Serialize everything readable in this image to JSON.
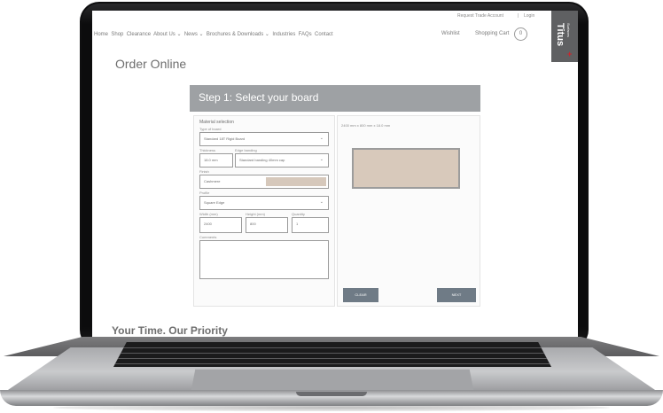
{
  "header": {
    "top_links": [
      "Request Trade Account",
      "Login"
    ],
    "nav_items": [
      "Home",
      "Shop",
      "Clearance",
      "About Us",
      "News",
      "Brochures & Downloads",
      "Industries",
      "FAQs",
      "Contact"
    ],
    "wishlist_label": "Wishlist",
    "cart_label": "Shopping Cart",
    "cart_count": "0",
    "brand_name": "Titus",
    "brand_sub": "Surfaces"
  },
  "page": {
    "title": "Order Online",
    "bottom_heading": "Your Time. Our Priority"
  },
  "form": {
    "step_title": "Step 1: Select your board",
    "section_label": "Material selection",
    "type_label": "Type of board",
    "type_value": "Standard 18T Rigid Board",
    "thickness_label": "Thickness",
    "thickness_value": "18.0 mm",
    "edge_label": "Edge banding",
    "edge_value": "Standard banding 40mm cap",
    "finish_label": "Finish",
    "finish_value": "Cashmere",
    "profile_label": "Profile",
    "profile_value": "Square Edge",
    "width_label": "Width (mm)",
    "width_value": "2400",
    "height_label": "Height (mm)",
    "height_value": "800",
    "quantity_label": "Quantity",
    "quantity_value": "1",
    "comments_label": "Comments",
    "preview_caption": "2400 mm x 800 mm x 18.0 mm",
    "clear_label": "CLEAR",
    "next_label": "NEXT",
    "swatch_color": "#d6c8bb"
  }
}
